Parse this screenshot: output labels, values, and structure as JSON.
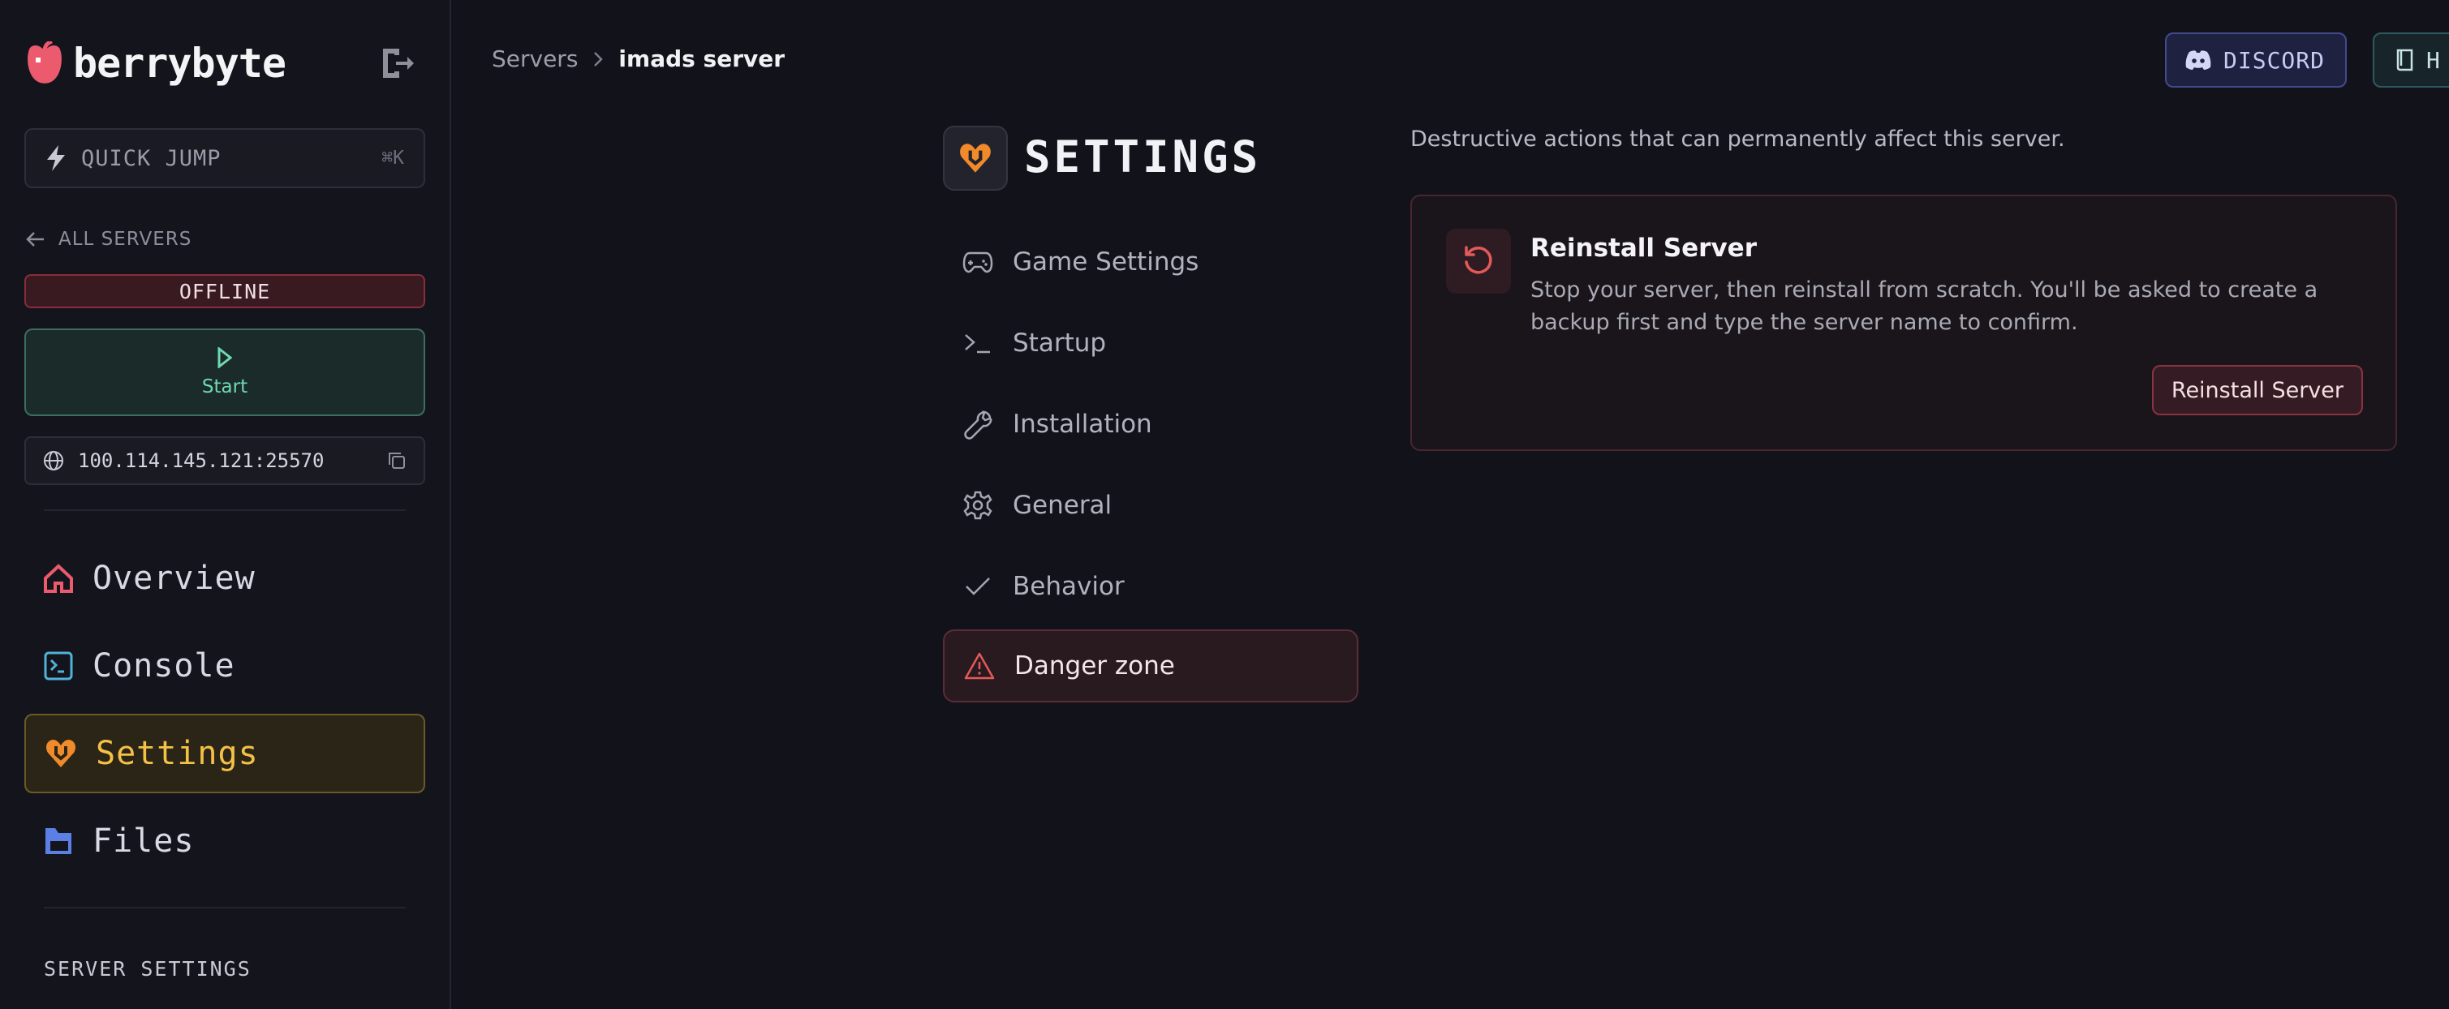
{
  "sidebar": {
    "logo_text": "berrybyte",
    "quick_jump": {
      "label": "QUICK JUMP",
      "shortcut": "⌘K"
    },
    "all_servers_label": "ALL SERVERS",
    "status_badge": "OFFLINE",
    "start_label": "Start",
    "ip_address": "100.114.145.121:25570",
    "nav": [
      {
        "label": "Overview",
        "icon": "home-icon"
      },
      {
        "label": "Console",
        "icon": "terminal-icon"
      },
      {
        "label": "Settings",
        "icon": "heart-tool-icon",
        "active": true
      },
      {
        "label": "Files",
        "icon": "folder-icon"
      }
    ],
    "section_label": "SERVER SETTINGS"
  },
  "topbar": {
    "breadcrumb": [
      "Servers",
      "imads server"
    ],
    "discord_label": "DISCORD",
    "help_label": "H"
  },
  "settings": {
    "title": "SETTINGS",
    "subnav": [
      {
        "label": "Game Settings",
        "icon": "gamepad-icon"
      },
      {
        "label": "Startup",
        "icon": "prompt-icon"
      },
      {
        "label": "Installation",
        "icon": "wrench-icon"
      },
      {
        "label": "General",
        "icon": "gear-icon"
      },
      {
        "label": "Behavior",
        "icon": "check-icon"
      },
      {
        "label": "Danger zone",
        "icon": "warning-icon",
        "active": true
      }
    ],
    "danger_description": "Destructive actions that can permanently affect this server.",
    "reinstall": {
      "title": "Reinstall Server",
      "description": "Stop your server, then reinstall from scratch. You'll be asked to create a backup first and type the server name to confirm.",
      "button_label": "Reinstall Server"
    }
  },
  "colors": {
    "accent_settings": "#f4c146",
    "offline": "#8a2c3c",
    "start": "#6fd8b1",
    "discord": "#434a8c",
    "danger": "#e25a5a"
  }
}
